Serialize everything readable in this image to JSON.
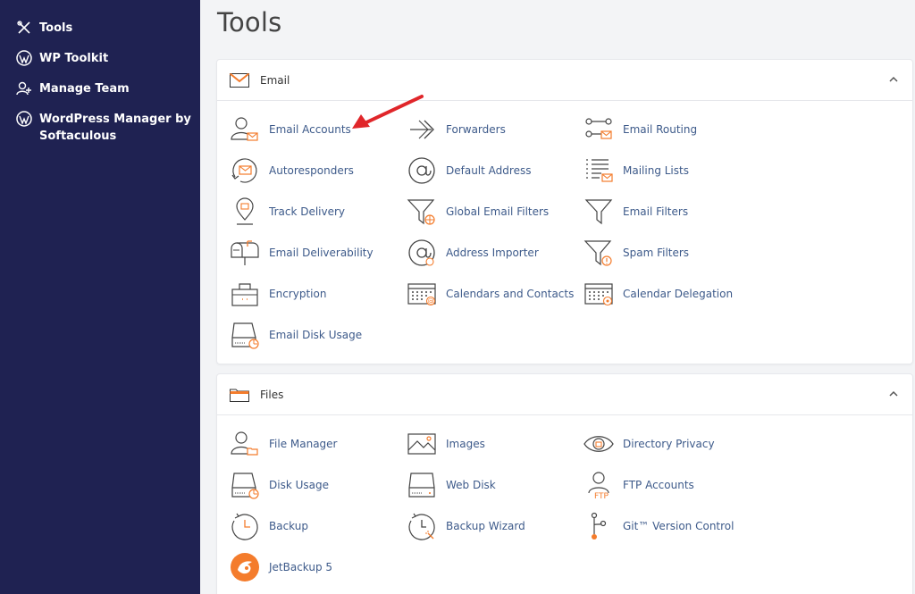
{
  "sidebar": {
    "items": [
      {
        "label": "Tools",
        "icon": "tools-icon"
      },
      {
        "label": "WP Toolkit",
        "icon": "wordpress-icon"
      },
      {
        "label": "Manage Team",
        "icon": "user-add-icon"
      },
      {
        "label": "WordPress Manager by Softaculous",
        "icon": "wordpress-icon"
      }
    ]
  },
  "page": {
    "title": "Tools"
  },
  "email_panel": {
    "title": "Email",
    "tools": [
      {
        "label": "Email Accounts",
        "icon": "email-accounts-icon"
      },
      {
        "label": "Forwarders",
        "icon": "forwarders-icon"
      },
      {
        "label": "Email Routing",
        "icon": "email-routing-icon"
      },
      {
        "label": "Autoresponders",
        "icon": "autoresponders-icon"
      },
      {
        "label": "Default Address",
        "icon": "at-sign-icon"
      },
      {
        "label": "Mailing Lists",
        "icon": "mailing-lists-icon"
      },
      {
        "label": "Track Delivery",
        "icon": "location-pin-icon"
      },
      {
        "label": "Global Email Filters",
        "icon": "globe-filter-icon"
      },
      {
        "label": "Email Filters",
        "icon": "filter-icon"
      },
      {
        "label": "Email Deliverability",
        "icon": "mailbox-icon"
      },
      {
        "label": "Address Importer",
        "icon": "at-sign-import-icon"
      },
      {
        "label": "Spam Filters",
        "icon": "spam-filter-icon"
      },
      {
        "label": "Encryption",
        "icon": "encryption-icon"
      },
      {
        "label": "Calendars and Contacts",
        "icon": "calendar-icon"
      },
      {
        "label": "Calendar Delegation",
        "icon": "calendar-delegation-icon"
      },
      {
        "label": "Email Disk Usage",
        "icon": "disk-usage-icon"
      }
    ]
  },
  "files_panel": {
    "title": "Files",
    "tools": [
      {
        "label": "File Manager",
        "icon": "file-manager-icon"
      },
      {
        "label": "Images",
        "icon": "images-icon"
      },
      {
        "label": "Directory Privacy",
        "icon": "eye-icon"
      },
      {
        "label": "Disk Usage",
        "icon": "disk-usage-icon"
      },
      {
        "label": "Web Disk",
        "icon": "web-disk-icon"
      },
      {
        "label": "FTP Accounts",
        "icon": "ftp-accounts-icon"
      },
      {
        "label": "Backup",
        "icon": "backup-icon"
      },
      {
        "label": "Backup Wizard",
        "icon": "backup-wizard-icon"
      },
      {
        "label": "Git™ Version Control",
        "icon": "git-icon"
      },
      {
        "label": "JetBackup 5",
        "icon": "jetbackup-icon"
      }
    ]
  },
  "colors": {
    "sidebar_bg": "#1f2252",
    "accent": "#f47c2c",
    "link": "#3d5a8a",
    "annotation_arrow": "#e0262a"
  }
}
